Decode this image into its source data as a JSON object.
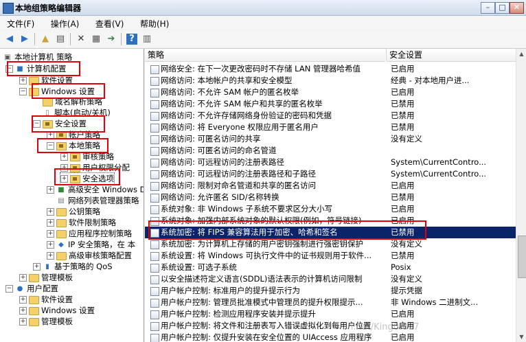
{
  "window": {
    "title": "本地组策略编辑器"
  },
  "menu": [
    "文件(F)",
    "操作(A)",
    "查看(V)",
    "帮助(H)"
  ],
  "tree": [
    {
      "label": "本地计算机 策略"
    },
    {
      "label": "计算机配置"
    },
    {
      "label": "软件设置"
    },
    {
      "label": "Windows 设置"
    },
    {
      "label": "域名解析策略"
    },
    {
      "label": "脚本(启动/关机)"
    },
    {
      "label": "安全设置"
    },
    {
      "label": "帐户策略"
    },
    {
      "label": "本地策略"
    },
    {
      "label": "审核策略"
    },
    {
      "label": "用户权限分配"
    },
    {
      "label": "安全选项"
    },
    {
      "label": "高级安全 Windows D"
    },
    {
      "label": "网络列表管理器策略"
    },
    {
      "label": "公钥策略"
    },
    {
      "label": "软件限制策略"
    },
    {
      "label": "应用程序控制策略"
    },
    {
      "label": "IP 安全策略，在 本"
    },
    {
      "label": "高级审核策略配置"
    },
    {
      "label": "基于策略的 QoS"
    },
    {
      "label": "管理模板"
    },
    {
      "label": "用户配置"
    },
    {
      "label": "软件设置"
    },
    {
      "label": "Windows 设置"
    },
    {
      "label": "管理模板"
    }
  ],
  "columns": {
    "policy": "策略",
    "setting": "安全设置"
  },
  "rows": [
    {
      "name": "网络安全: 在下一次更改密码时不存储 LAN 管理器哈希值",
      "value": "已启用"
    },
    {
      "name": "网络访问: 本地帐户的共享和安全模型",
      "value": "经典 - 对本地用户进..."
    },
    {
      "name": "网络访问: 不允许 SAM 帐户的匿名枚举",
      "value": "已启用"
    },
    {
      "name": "网络访问: 不允许 SAM 帐户和共享的匿名枚举",
      "value": "已禁用"
    },
    {
      "name": "网络访问: 不允许存储网络身份验证的密码和凭据",
      "value": "已禁用"
    },
    {
      "name": "网络访问: 将 Everyone 权限应用于匿名用户",
      "value": "已禁用"
    },
    {
      "name": "网络访问: 可匿名访问的共享",
      "value": "没有定义"
    },
    {
      "name": "网络访问: 可匿名访问的命名管道",
      "value": ""
    },
    {
      "name": "网络访问: 可远程访问的注册表路径",
      "value": "System\\CurrentContro..."
    },
    {
      "name": "网络访问: 可远程访问的注册表路径和子路径",
      "value": "System\\CurrentContro..."
    },
    {
      "name": "网络访问: 限制对命名管道和共享的匿名访问",
      "value": "已启用"
    },
    {
      "name": "网络访问: 允许匿名 SID/名称转换",
      "value": "已禁用"
    },
    {
      "name": "系统对象: 非 Windows 子系统不要求区分大小写",
      "value": "已启用"
    },
    {
      "name": "系统对象: 加强内部系统对象的默认权限(例如，符号链接)",
      "value": "已启用"
    },
    {
      "name": "系统加密: 将 FIPS 兼容算法用于加密、哈希和签名",
      "value": "已禁用"
    },
    {
      "name": "系统加密: 为计算机上存储的用户密钥强制进行强密钥保护",
      "value": "没有定义"
    },
    {
      "name": "系统设置: 将 Windows 可执行文件中的证书规则用于软件...",
      "value": "已禁用"
    },
    {
      "name": "系统设置: 可选子系统",
      "value": "Posix"
    },
    {
      "name": "以安全描述符定义语言(SDDL)语法表示的计算机访问限制",
      "value": "没有定义"
    },
    {
      "name": "用户帐户控制: 标准用户的提升提示行为",
      "value": "提示凭据"
    },
    {
      "name": "用户帐户控制: 管理员批准模式中管理员的提升权限提示...",
      "value": "非 Windows 二进制文..."
    },
    {
      "name": "用户帐户控制: 检测应用程序安装并提示提升",
      "value": "已启用"
    },
    {
      "name": "用户帐户控制: 将文件和注册表写入错误虚拟化到每用户位置",
      "value": "已启用"
    },
    {
      "name": "用户帐户控制: 仅提升安装在安全位置的 UIAccess 应用程序",
      "value": "已启用"
    }
  ],
  "watermark": "n.net/King0f007"
}
